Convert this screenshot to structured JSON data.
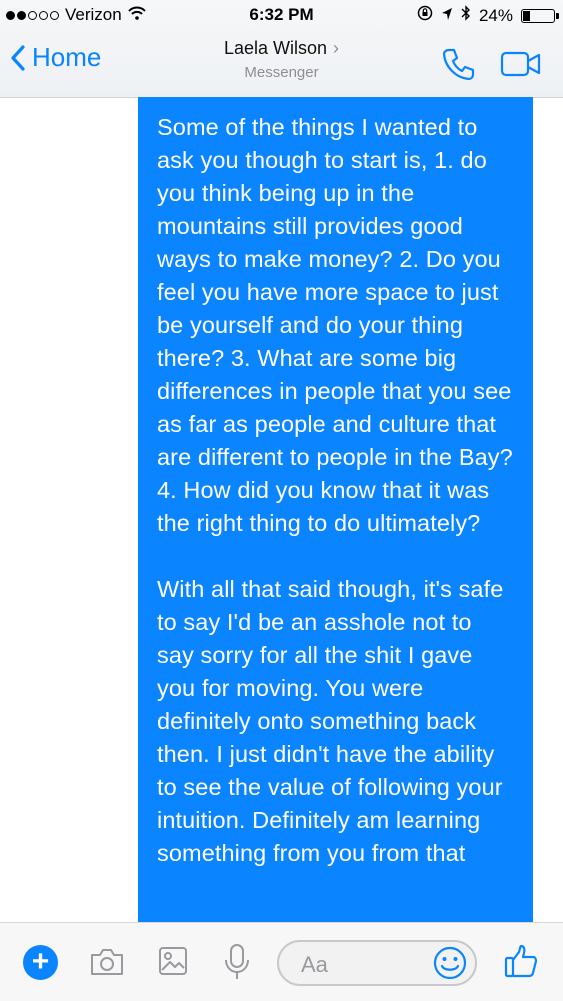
{
  "status_bar": {
    "carrier": "Verizon",
    "time": "6:32 PM",
    "battery_text": "24%",
    "battery_level": 0.24
  },
  "nav": {
    "back_label": "Home",
    "contact_name": "Laela Wilson",
    "subtitle": "Messenger"
  },
  "message": {
    "paragraphs": [
      "Some of the things I wanted to ask you though to start is, 1. do you think being up in the mountains still provides good ways to make money? 2. Do you feel you have more space to just be yourself and do your thing there? 3. What are some big differences in people that you see as far as people and culture that are different to people in the Bay? 4. How did you know that it was the right thing to do ultimately?",
      "With all that said though, it's safe to say I'd be an asshole not to say sorry for all the shit I gave you for moving. You were definitely onto something back then. I just didn't have the ability to see the value of following your intuition. Definitely am learning something from you from that"
    ]
  },
  "composer": {
    "placeholder": "Aa",
    "icons": [
      "plus-icon",
      "camera-icon",
      "image-icon",
      "microphone-icon",
      "emoji-icon",
      "thumbs-up-icon"
    ]
  },
  "colors": {
    "accent": "#0a84ff",
    "bubble": "#0a84ff",
    "muted": "#8e8e93"
  }
}
